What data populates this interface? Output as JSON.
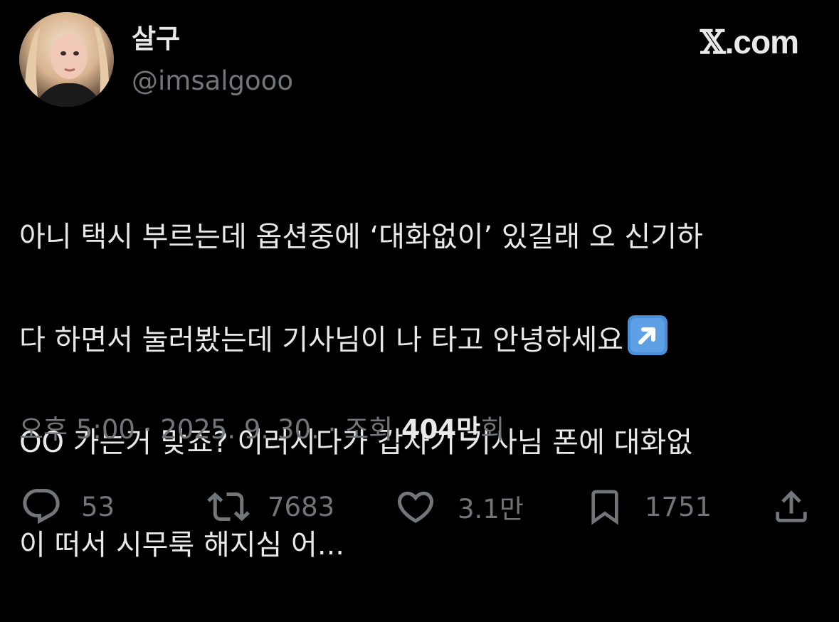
{
  "user": {
    "display_name": "살구",
    "handle": "@imsalgooo"
  },
  "brand": {
    "x_symbol": "𝕏",
    "domain": ".com"
  },
  "tweet": {
    "lines": [
      "아니 택시 부르는데 옵션중에 ‘대화없이’ 있길래 오 신기하",
      "다 하면서 눌러봤는데 기사님이 나 타고 안녕하세요",
      "OO 가는거 맞죠? 이러시다가 갑자기 기사님 폰에 대화없",
      "이 떠서 시무룩 해지심 어..."
    ],
    "emoji": "up-right-arrow-emoji"
  },
  "meta": {
    "timestamp": "오후 5:00 · 2025. 9. 30. · 조회 ",
    "views_count": "404만",
    "views_suffix": "회"
  },
  "actions": {
    "replies": "53",
    "reposts": "7683",
    "likes": "3.1만",
    "bookmarks": "1751"
  },
  "icons": {
    "reply": "speech-bubble-icon",
    "repost": "repost-arrows-icon",
    "like": "heart-icon",
    "bookmark": "bookmark-icon",
    "share": "share-upload-icon"
  },
  "colors": {
    "background": "#000000",
    "primary_text": "#e7e9ea",
    "secondary_text": "#71767b",
    "emoji_blue": "#4a90d9"
  }
}
